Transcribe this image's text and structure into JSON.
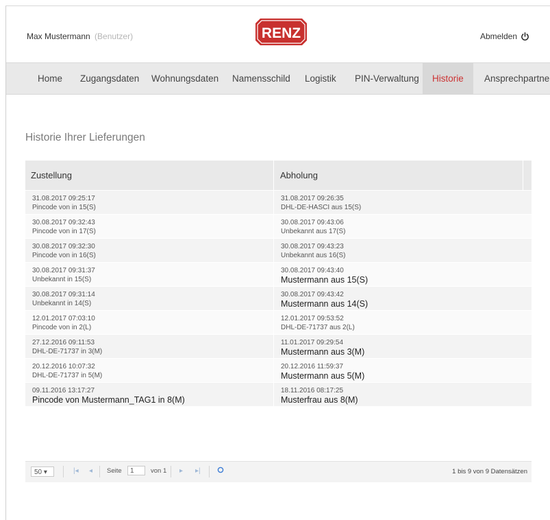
{
  "header": {
    "user_name": "Max Mustermann",
    "user_role": "(Benutzer)",
    "logo_text": "RENZ",
    "logout_label": "Abmelden",
    "brand_color": "#c8312f"
  },
  "nav": {
    "items": [
      {
        "label": "Home"
      },
      {
        "label": "Zugangsdaten"
      },
      {
        "label": "Wohnungsdaten"
      },
      {
        "label": "Namensschild"
      },
      {
        "label": "Logistik"
      },
      {
        "label": "PIN-Verwaltung"
      },
      {
        "label": "Historie",
        "active": true
      },
      {
        "label": "Ansprechpartner"
      }
    ]
  },
  "section": {
    "title": "Historie Ihrer Lieferungen"
  },
  "table": {
    "columns": [
      "Zustellung",
      "Abholung"
    ],
    "rows": [
      {
        "z_time": "31.08.2017 09:25:17",
        "z_text": "Pincode von in 15(S)",
        "a_time": "31.08.2017 09:26:35",
        "a_text": "DHL-DE-HASCI aus 15(S)"
      },
      {
        "z_time": "30.08.2017 09:32:43",
        "z_text": "Pincode von in 17(S)",
        "a_time": "30.08.2017 09:43:06",
        "a_text": "Unbekannt aus 17(S)"
      },
      {
        "z_time": "30.08.2017 09:32:30",
        "z_text": "Pincode von in 16(S)",
        "a_time": "30.08.2017 09:43:23",
        "a_text": "Unbekannt aus 16(S)"
      },
      {
        "z_time": "30.08.2017 09:31:37",
        "z_text": "Unbekannt in 15(S)",
        "a_time": "30.08.2017 09:43:40",
        "a_text": "Mustermann aus 15(S)"
      },
      {
        "z_time": "30.08.2017 09:31:14",
        "z_text": "Unbekannt in 14(S)",
        "a_time": "30.08.2017 09:43:42",
        "a_text": "Mustermann aus 14(S)"
      },
      {
        "z_time": "12.01.2017 07:03:10",
        "z_text": "Pincode von in 2(L)",
        "a_time": "12.01.2017 09:53:52",
        "a_text": "DHL-DE-71737 aus 2(L)"
      },
      {
        "z_time": "27.12.2016 09:11:53",
        "z_text": "DHL-DE-71737 in 3(M)",
        "a_time": "11.01.2017 09:29:54",
        "a_text": "Mustermann aus 3(M)"
      },
      {
        "z_time": "20.12.2016 10:07:32",
        "z_text": "DHL-DE-71737 in 5(M)",
        "a_time": "20.12.2016 11:59:37",
        "a_text": "Mustermann aus 5(M)"
      },
      {
        "z_time": "09.11.2016 13:17:27",
        "z_text": "Pincode von Mustermann_TAG1 in 8(M)",
        "a_time": "18.11.2016 08:17:25",
        "a_text": "Musterfrau aus 8(M)"
      }
    ]
  },
  "pager": {
    "page_size": "50",
    "page_label": "Seite",
    "page_value": "1",
    "of_label": "von 1",
    "info": "1 bis 9 von 9 Datensätzen"
  }
}
